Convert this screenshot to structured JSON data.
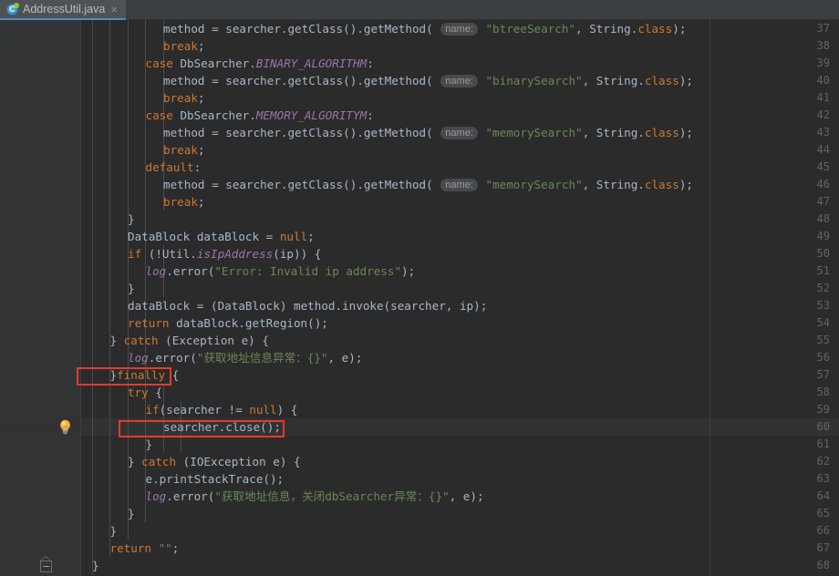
{
  "window": {
    "theme": "darcula",
    "accent_color": "#4a88c7",
    "background": "#2b2b2b",
    "gutter_background": "#313335"
  },
  "tab": {
    "title": "AddressUtil.java",
    "icon": "java-class-icon",
    "close_glyph": "×"
  },
  "editor": {
    "first_line": 37,
    "last_line": 68,
    "caret_line": 60,
    "line_numbers": [
      37,
      38,
      39,
      40,
      41,
      42,
      43,
      44,
      45,
      46,
      47,
      48,
      49,
      50,
      51,
      52,
      53,
      54,
      55,
      56,
      57,
      58,
      59,
      60,
      61,
      62,
      63,
      64,
      65,
      66,
      67,
      68
    ],
    "lightbulb_line": 60,
    "fold_line": 68,
    "parameter_hint_label": "name:"
  },
  "code_lines": [
    {
      "n": 37,
      "indent": 5,
      "text": "method = searcher.getClass().getMethod( name: \"btreeSearch\", String.class);"
    },
    {
      "n": 38,
      "indent": 5,
      "text": "break;"
    },
    {
      "n": 39,
      "indent": 4,
      "text": "case DbSearcher.BINARY_ALGORITHM:"
    },
    {
      "n": 40,
      "indent": 5,
      "text": "method = searcher.getClass().getMethod( name: \"binarySearch\", String.class);"
    },
    {
      "n": 41,
      "indent": 5,
      "text": "break;"
    },
    {
      "n": 42,
      "indent": 4,
      "text": "case DbSearcher.MEMORY_ALGORITYM:"
    },
    {
      "n": 43,
      "indent": 5,
      "text": "method = searcher.getClass().getMethod( name: \"memorySearch\", String.class);"
    },
    {
      "n": 44,
      "indent": 5,
      "text": "break;"
    },
    {
      "n": 45,
      "indent": 4,
      "text": "default:"
    },
    {
      "n": 46,
      "indent": 5,
      "text": "method = searcher.getClass().getMethod( name: \"memorySearch\", String.class);"
    },
    {
      "n": 47,
      "indent": 5,
      "text": "break;"
    },
    {
      "n": 48,
      "indent": 3,
      "text": "}"
    },
    {
      "n": 49,
      "indent": 3,
      "text": "DataBlock dataBlock = null;"
    },
    {
      "n": 50,
      "indent": 3,
      "text": "if (!Util.isIpAddress(ip)) {"
    },
    {
      "n": 51,
      "indent": 4,
      "text": "log.error(\"Error: Invalid ip address\");"
    },
    {
      "n": 52,
      "indent": 3,
      "text": "}"
    },
    {
      "n": 53,
      "indent": 3,
      "text": "dataBlock = (DataBlock) method.invoke(searcher, ip);"
    },
    {
      "n": 54,
      "indent": 3,
      "text": "return dataBlock.getRegion();"
    },
    {
      "n": 55,
      "indent": 2,
      "text": "} catch (Exception e) {"
    },
    {
      "n": 56,
      "indent": 3,
      "text": "log.error(\"获取地址信息异常：{}\", e);"
    },
    {
      "n": 57,
      "indent": 2,
      "text": "}finally {"
    },
    {
      "n": 58,
      "indent": 3,
      "text": "try {"
    },
    {
      "n": 59,
      "indent": 4,
      "text": "if(searcher != null) {"
    },
    {
      "n": 60,
      "indent": 5,
      "text": "searcher.close();"
    },
    {
      "n": 61,
      "indent": 4,
      "text": "}"
    },
    {
      "n": 62,
      "indent": 3,
      "text": "} catch (IOException e) {"
    },
    {
      "n": 63,
      "indent": 4,
      "text": "e.printStackTrace();"
    },
    {
      "n": 64,
      "indent": 4,
      "text": "log.error(\"获取地址信息，关闭dbSearcher异常：{}\", e);"
    },
    {
      "n": 65,
      "indent": 3,
      "text": "}"
    },
    {
      "n": 66,
      "indent": 2,
      "text": "}"
    },
    {
      "n": 67,
      "indent": 2,
      "text": "return \"\";"
    },
    {
      "n": 68,
      "indent": 1,
      "text": "}"
    }
  ],
  "annotations": [
    {
      "id": "annot-finally",
      "label": "finally-block-highlight",
      "target_line": 57,
      "color": "#e33b2e"
    },
    {
      "id": "annot-close",
      "label": "searcher-close-highlight",
      "target_line": 60,
      "color": "#e33b2e"
    }
  ],
  "syntax_colors": {
    "keyword": "#cc7832",
    "string": "#6a8759",
    "static_field": "#9876aa",
    "default_text": "#a9b7c6",
    "line_number": "#606366",
    "hint_background": "#474b4e",
    "hint_text": "#9b9b9b"
  }
}
